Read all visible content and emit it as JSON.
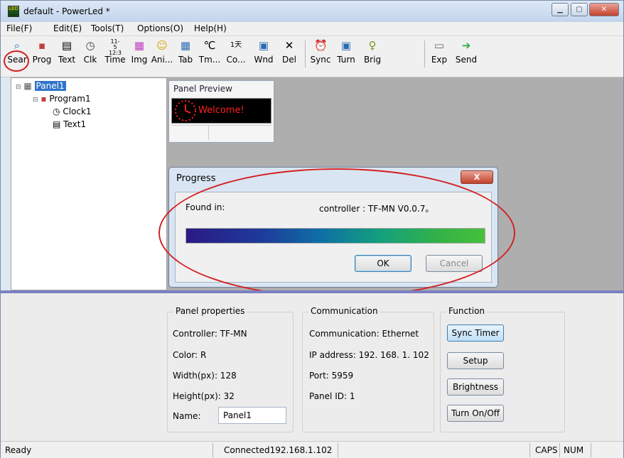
{
  "window": {
    "title": "default - PowerLed *",
    "app_icon_text": "LED"
  },
  "menubar": [
    "File(F)",
    "Edit(E)",
    "Tools(T)",
    "Options(O)",
    "Help(H)"
  ],
  "toolbar": [
    {
      "label": "Sear",
      "icon": "search-icon"
    },
    {
      "label": "Prog",
      "icon": "program-icon"
    },
    {
      "label": "Text",
      "icon": "text-icon"
    },
    {
      "label": "Clk",
      "icon": "clock-icon"
    },
    {
      "label": "Time",
      "icon": "time-icon"
    },
    {
      "label": "Img",
      "icon": "image-icon"
    },
    {
      "label": "Ani...",
      "icon": "animation-icon"
    },
    {
      "label": "Tab",
      "icon": "table-icon"
    },
    {
      "label": "Tm...",
      "icon": "temperature-icon"
    },
    {
      "label": "Co...",
      "icon": "countdown-icon"
    },
    {
      "label": "Wnd",
      "icon": "window-icon"
    },
    {
      "label": "Del",
      "icon": "delete-icon"
    },
    {
      "label": "Sync",
      "icon": "sync-icon"
    },
    {
      "label": "Turn",
      "icon": "turn-icon"
    },
    {
      "label": "Brig",
      "icon": "brightness-icon"
    },
    {
      "label": "Exp",
      "icon": "export-icon"
    },
    {
      "label": "Send",
      "icon": "send-icon"
    }
  ],
  "tree": {
    "panel": "Panel1",
    "program": "Program1",
    "clock": "Clock1",
    "text": "Text1"
  },
  "preview": {
    "title": "Panel Preview",
    "led_text": "Welcome!"
  },
  "dialog": {
    "title": "Progress",
    "close": "X",
    "found_label": "Found in:",
    "found_value": "controller : TF-MN V0.0.7。",
    "progress": 1.0,
    "ok": "OK",
    "cancel": "Cancel"
  },
  "panel_properties": {
    "title": "Panel properties",
    "controller": "Controller: TF-MN",
    "color": "Color: R",
    "width": "Width(px): 128",
    "height": "Height(px): 32",
    "name_label": "Name:",
    "name_value": "Panel1"
  },
  "communication": {
    "title": "Communication",
    "mode": "Communication: Ethernet",
    "ip": "IP address: 192. 168. 1. 102",
    "port": "Port: 5959",
    "panel_id": "Panel ID: 1"
  },
  "function": {
    "title": "Function",
    "sync": "Sync Timer",
    "setup": "Setup",
    "brightness": "Brightness",
    "turn": "Turn On/Off"
  },
  "status": {
    "ready": "Ready",
    "connection": "Connected192.168.1.102",
    "caps": "CAPS",
    "num": "NUM"
  },
  "colors": {
    "accent": "#3074c9",
    "annotation": "#d42020",
    "led_text": "#ff2020"
  }
}
